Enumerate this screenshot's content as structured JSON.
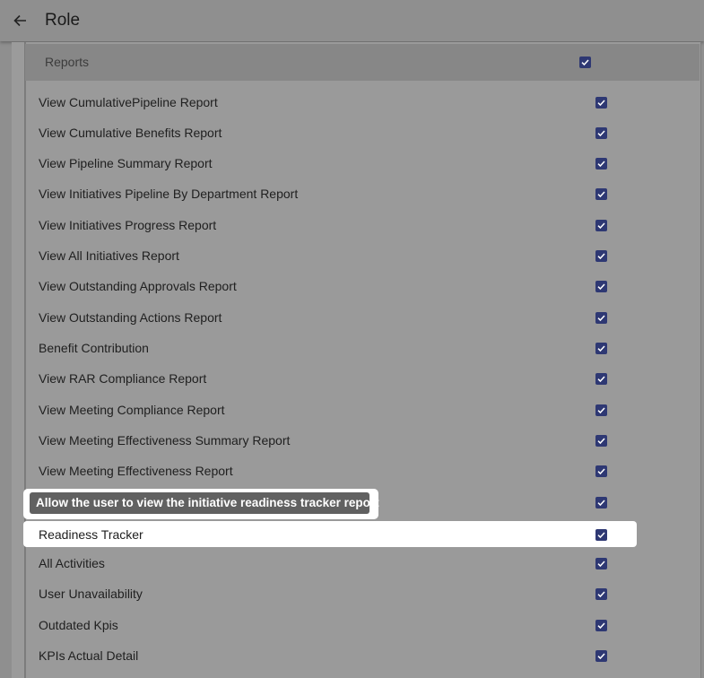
{
  "header": {
    "title": "Role",
    "back_icon": "arrow-left-icon"
  },
  "section": {
    "label": "Reports",
    "checked": true
  },
  "tooltip": {
    "text": "Allow the user to view the initiative readiness tracker report"
  },
  "accent_color": "#2e3873",
  "rows": [
    {
      "label": "View CumulativePipeline Report",
      "checked": true
    },
    {
      "label": "View Cumulative Benefits Report",
      "checked": true
    },
    {
      "label": "View Pipeline Summary Report",
      "checked": true
    },
    {
      "label": "View Initiatives Pipeline By Department Report",
      "checked": true
    },
    {
      "label": "View Initiatives Progress Report",
      "checked": true
    },
    {
      "label": "View All Initiatives Report",
      "checked": true
    },
    {
      "label": "View Outstanding Approvals Report",
      "checked": true
    },
    {
      "label": "View Outstanding Actions Report",
      "checked": true
    },
    {
      "label": "Benefit Contribution",
      "checked": true
    },
    {
      "label": "View RAR Compliance Report",
      "checked": true
    },
    {
      "label": "View Meeting Compliance Report",
      "checked": true
    },
    {
      "label": "View Meeting Effectiveness Summary Report",
      "checked": true
    },
    {
      "label": "View Meeting Effectiveness Report",
      "checked": true
    },
    {
      "label": "",
      "checked": true
    },
    {
      "label": "Readiness Tracker",
      "checked": true
    },
    {
      "label": "All Activities",
      "checked": true
    },
    {
      "label": "User Unavailability",
      "checked": true
    },
    {
      "label": "Outdated Kpis",
      "checked": true
    },
    {
      "label": "KPIs Actual Detail",
      "checked": true
    }
  ]
}
